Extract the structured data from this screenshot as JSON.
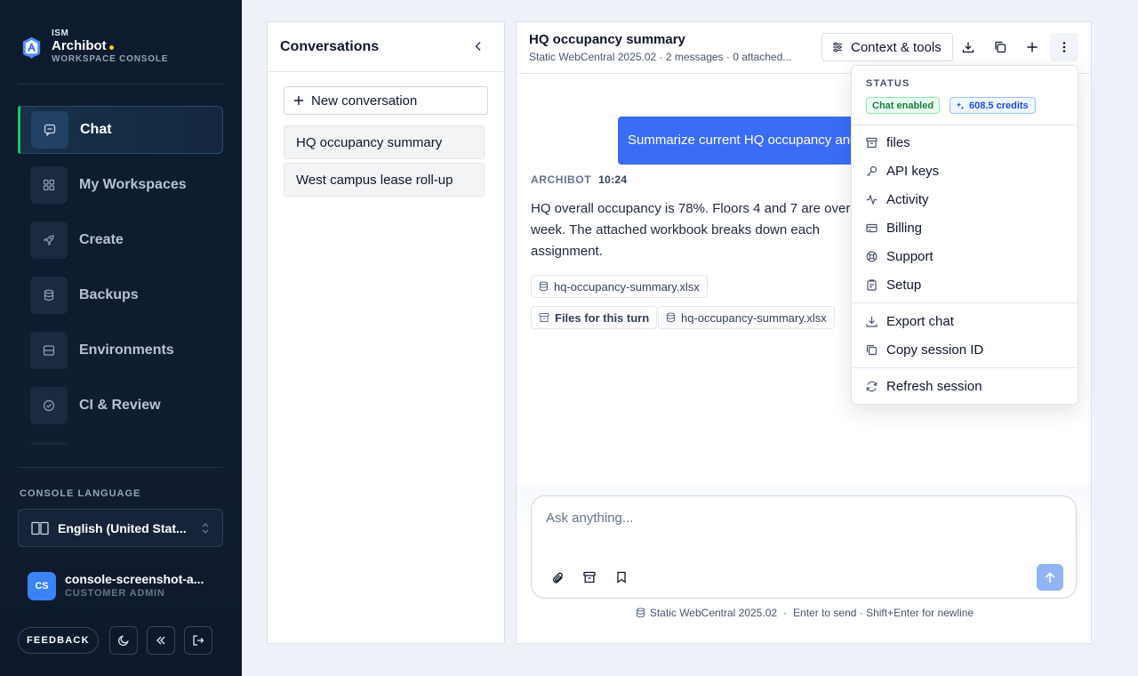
{
  "sidebar": {
    "brand": {
      "prefix": "ISM",
      "name": "Archibot",
      "subtitle": "WORKSPACE CONSOLE"
    },
    "nav": [
      {
        "label": "Chat",
        "icon": "chat-icon",
        "active": true
      },
      {
        "label": "My Workspaces",
        "icon": "grid-icon",
        "active": false
      },
      {
        "label": "Create",
        "icon": "rocket-icon",
        "active": false
      },
      {
        "label": "Backups",
        "icon": "database-icon",
        "active": false
      },
      {
        "label": "Environments",
        "icon": "server-icon",
        "active": false
      },
      {
        "label": "CI & Review",
        "icon": "check-circle-icon",
        "active": false
      }
    ],
    "language": {
      "label": "CONSOLE LANGUAGE",
      "value": "English (United Stat..."
    },
    "user": {
      "initials": "CS",
      "name": "console-screenshot-a...",
      "role": "CUSTOMER ADMIN"
    },
    "footer": {
      "feedback": "FEEDBACK"
    }
  },
  "conversations": {
    "title": "Conversations",
    "new_label": "New conversation",
    "items": [
      "HQ occupancy summary",
      "West campus lease roll-up"
    ]
  },
  "chat": {
    "title": "HQ occupancy summary",
    "subtitle": "Static WebCentral 2025.02 · 2 messages · 0 attached...",
    "context_button": "Context & tools",
    "user_message": "Summarize current HQ occupancy and",
    "bot": {
      "name": "ARCHIBOT",
      "time": "10:24",
      "text": "HQ overall occupancy is 78%. Floors 4 and 7 are over week. The attached workbook breaks down each assignment.",
      "attachment": "hq-occupancy-summary.xlsx",
      "files_label": "Files for this turn",
      "file_chip": "hq-occupancy-summary.xlsx"
    },
    "composer": {
      "placeholder": "Ask anything...",
      "footer_source": "Static WebCentral 2025.02",
      "footer_hint": "Enter to send · Shift+Enter for newline",
      "separator": "·"
    }
  },
  "menu": {
    "status_label": "STATUS",
    "chat_badge": "Chat enabled",
    "credits_badge": "608.5 credits",
    "items": [
      "files",
      "API keys",
      "Activity",
      "Billing",
      "Support",
      "Setup"
    ],
    "actions": [
      "Export chat",
      "Copy session ID"
    ],
    "refresh": "Refresh session"
  },
  "colors": {
    "sidebar_bg": "#0d1b2e",
    "accent_blue": "#3b6cf5",
    "active_green": "#22c55e",
    "brand_dot": "#facc15"
  }
}
